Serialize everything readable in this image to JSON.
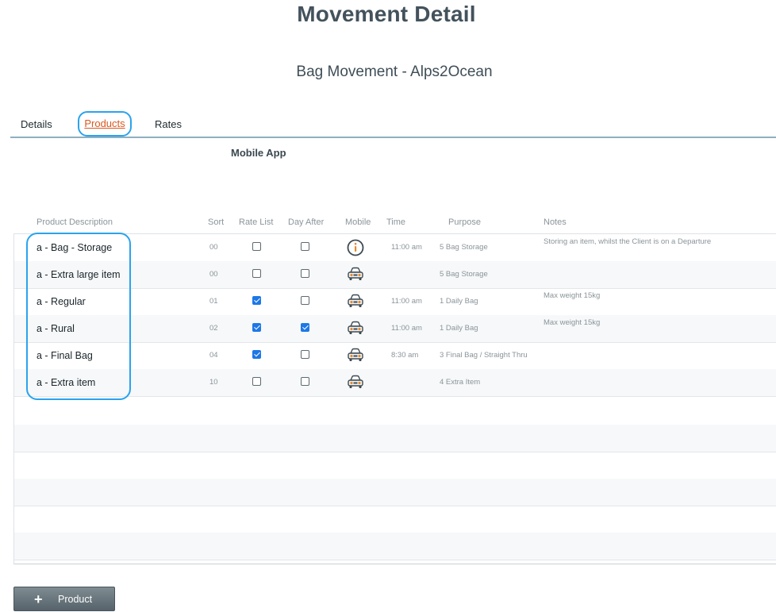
{
  "page": {
    "title": "Movement Detail",
    "subtitle": "Bag Movement - Alps2Ocean"
  },
  "tabs": [
    {
      "label": "Details",
      "active": false
    },
    {
      "label": "Products",
      "active": true
    },
    {
      "label": "Rates",
      "active": false
    }
  ],
  "section_label": "Mobile App",
  "table": {
    "columns": [
      "Product Description",
      "Sort",
      "Rate List",
      "Day After",
      "Mobile",
      "Time",
      "Purpose",
      "Notes"
    ],
    "rows": [
      {
        "description": "a - Bag - Storage",
        "sort": "00",
        "rate_list": false,
        "day_after": false,
        "mobile_icon": "info-icon",
        "time": "11:00 am",
        "purpose": "5  Bag Storage",
        "notes": "Storing an item, whilst the Client is on a Departure"
      },
      {
        "description": "a - Extra large item",
        "sort": "00",
        "rate_list": false,
        "day_after": false,
        "mobile_icon": "car-icon",
        "time": "",
        "purpose": "5  Bag Storage",
        "notes": ""
      },
      {
        "description": "a - Regular",
        "sort": "01",
        "rate_list": true,
        "day_after": false,
        "mobile_icon": "car-icon",
        "time": "11:00 am",
        "purpose": "1  Daily Bag",
        "notes": "Max weight 15kg"
      },
      {
        "description": "a - Rural",
        "sort": "02",
        "rate_list": true,
        "day_after": true,
        "mobile_icon": "car-icon",
        "time": "11:00 am",
        "purpose": "1  Daily Bag",
        "notes": "Max weight 15kg"
      },
      {
        "description": "a - Final Bag",
        "sort": "04",
        "rate_list": true,
        "day_after": false,
        "mobile_icon": "car-icon",
        "time": "8:30 am",
        "purpose": "3  Final Bag / Straight Thru",
        "notes": ""
      },
      {
        "description": "a - Extra item",
        "sort": "10",
        "rate_list": false,
        "day_after": false,
        "mobile_icon": "car-icon",
        "time": "",
        "purpose": "4  Extra Item",
        "notes": ""
      }
    ],
    "empty_rows": 6
  },
  "add_button": {
    "label": "Product",
    "icon": "plus-icon"
  },
  "colors": {
    "accent_outline": "#2aa3ee",
    "active_tab": "#d9581f",
    "checkbox_checked": "#1d78e6",
    "icon_orange": "#e58a2c",
    "button_bg": "#5e6b72"
  }
}
